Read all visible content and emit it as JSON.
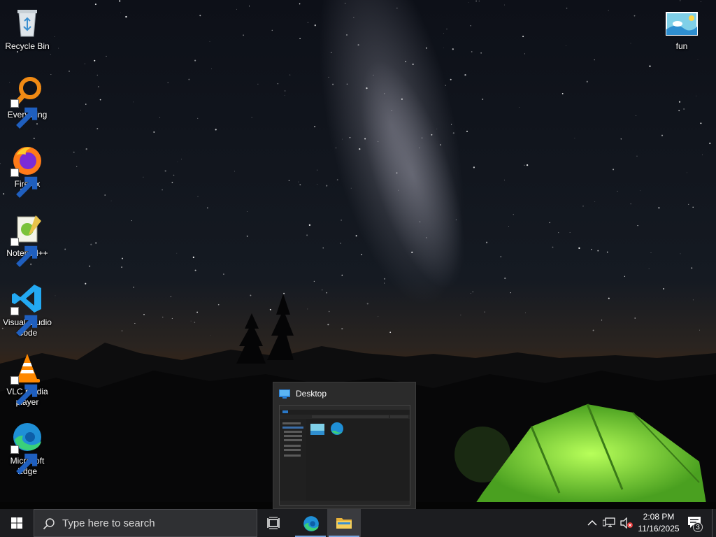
{
  "desktop": {
    "icons": [
      {
        "label": "Recycle Bin",
        "icon": "recycle-bin-icon"
      },
      {
        "label": "Everything",
        "icon": "everything-search-icon"
      },
      {
        "label": "Firefox",
        "icon": "firefox-icon"
      },
      {
        "label": "Notepad++",
        "icon": "notepadpp-icon"
      },
      {
        "label": "Visual Studio Code",
        "icon": "vscode-icon"
      },
      {
        "label": "VLC media player",
        "icon": "vlc-icon"
      },
      {
        "label": "Microsoft Edge",
        "icon": "edge-icon"
      },
      {
        "label": "fun",
        "icon": "image-file-icon"
      }
    ]
  },
  "preview": {
    "title": "Desktop"
  },
  "taskbar": {
    "search_placeholder": "Type here to search",
    "apps": [
      {
        "name": "Task View",
        "icon": "task-view-icon"
      },
      {
        "name": "Microsoft Edge",
        "icon": "edge-icon"
      },
      {
        "name": "File Explorer",
        "icon": "folder-icon",
        "active": true
      }
    ],
    "tray": {
      "time": "2:08 PM",
      "date": "11/16/2025",
      "notifications": "3"
    }
  },
  "colors": {
    "taskbar": "#1c1d20",
    "accent": "#7aa7e0",
    "tent": "#7ad43a"
  }
}
